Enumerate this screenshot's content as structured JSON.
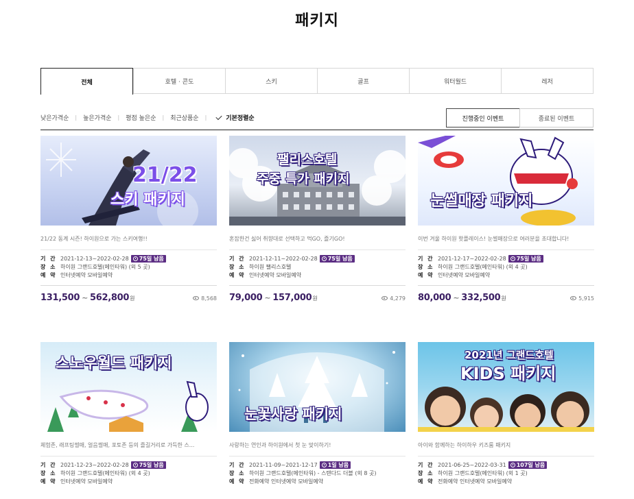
{
  "page": {
    "title": "패키지"
  },
  "tabs": [
    {
      "label": "전체"
    },
    {
      "label": "호텔 · 콘도"
    },
    {
      "label": "스키"
    },
    {
      "label": "골프"
    },
    {
      "label": "워터월드"
    },
    {
      "label": "레저"
    }
  ],
  "sort": {
    "options": [
      "낮은가격순",
      "높은가격순",
      "평점 높은순",
      "최근상품순"
    ],
    "selected_label": "기본정렬순"
  },
  "events": {
    "ongoing": "진행중인 이벤트",
    "ended": "종료된 이벤트"
  },
  "labels": {
    "period": "기 간",
    "place": "장 소",
    "reserve": "예 약",
    "won": "원",
    "tilde": "~"
  },
  "cards": [
    {
      "banner": [
        "21/22",
        "스키 패키지"
      ],
      "desc": "21/22 동계 시즌! 하이원으로 가는 스키여행!!",
      "period": "2021-12-13~2022-02-28",
      "badge": "75일 남음",
      "place": "하이원 그랜드호텔(메인타워) (외 5 곳)",
      "reserve": "인터넷예약 모바일예약",
      "price_min": "131,500",
      "price_max": "562,800",
      "views": "8,568"
    },
    {
      "banner": [
        "팰리스호텔",
        "주중 특가 패키지"
      ],
      "desc": "혼잡한건 싫어 취향대로 선택하고 먹GO, 즐기GO!",
      "period": "2021-12-11~2022-02-28",
      "badge": "75일 남음",
      "place": "하이원 팰리스호텔",
      "reserve": "인터넷예약 모바일예약",
      "price_min": "79,000",
      "price_max": "157,000",
      "views": "4,279"
    },
    {
      "banner": [
        "눈썰매장 패키지"
      ],
      "desc": "이번 겨울 하이원 핫플레이스! 눈썰매장으로 여러분을 초대합니다!",
      "period": "2021-12-17~2022-02-28",
      "badge": "75일 남음",
      "place": "하이원 그랜드호텔(메인타워) (외 4 곳)",
      "reserve": "인터넷예약 모바일예약",
      "price_min": "80,000",
      "price_max": "332,500",
      "views": "5,915"
    },
    {
      "banner": [
        "스노우월드 패키지"
      ],
      "desc": "체험존, 래프팅썰매, 얼음썰매, 포토존 등의 즐길거리로 가득한 스...",
      "period": "2021-12-23~2022-02-28",
      "badge": "75일 남음",
      "place": "하이원 그랜드호텔(메인타워) (외 4 곳)",
      "reserve": "인터넷예약 모바일예약"
    },
    {
      "banner": [
        "눈꽃사랑 패키지"
      ],
      "desc": "사랑하는 연인과 하이원에서 첫 눈 맞이하기!",
      "period": "2021-11-09~2021-12-17",
      "badge": "1일 남음",
      "place": "하이원 그랜드호텔(메인타워) - 스탠다드 더블 (외 8 곳)",
      "reserve": "전화예약 인터넷예약 모바일예약"
    },
    {
      "banner": [
        "2021년 그랜드호텔",
        "KIDS 패키지"
      ],
      "desc": "아이와 함께하는 하이하우 키즈룸 패키지",
      "period": "2021-06-25~2022-03-31",
      "badge": "107일 남음",
      "place": "하이원 그랜드호텔(메인타워) (외 1 곳)",
      "reserve": "전화예약 인터넷예약 모바일예약"
    }
  ]
}
